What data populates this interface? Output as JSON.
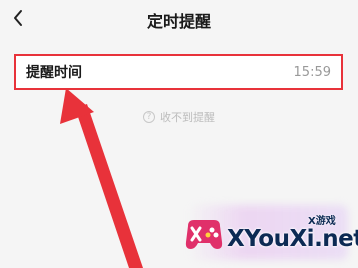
{
  "header": {
    "title": "定时提醒",
    "back_icon": "chevron-left-icon"
  },
  "reminder_row": {
    "label": "提醒时间",
    "value": "15:59"
  },
  "help": {
    "icon": "question-circle-icon",
    "icon_glyph": "?",
    "text": "收不到提醒"
  },
  "watermark": {
    "site": "XYouXi.net",
    "sub": "X游戏"
  },
  "colors": {
    "highlight": "#e8323a",
    "arrow": "#e8323a",
    "background": "#f5f5f5"
  }
}
